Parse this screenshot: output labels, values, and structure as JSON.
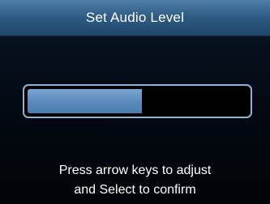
{
  "dialog": {
    "title": "Set Audio Level"
  },
  "audio_level": {
    "fraction": 0.52
  },
  "instructions": {
    "line1": "Press arrow keys to adjust",
    "line2": "and Select to confirm"
  },
  "colors": {
    "titlebar": "#2f5d85",
    "fill": "#5b8cbd",
    "border": "#8fb2d6",
    "background": "#030911"
  }
}
